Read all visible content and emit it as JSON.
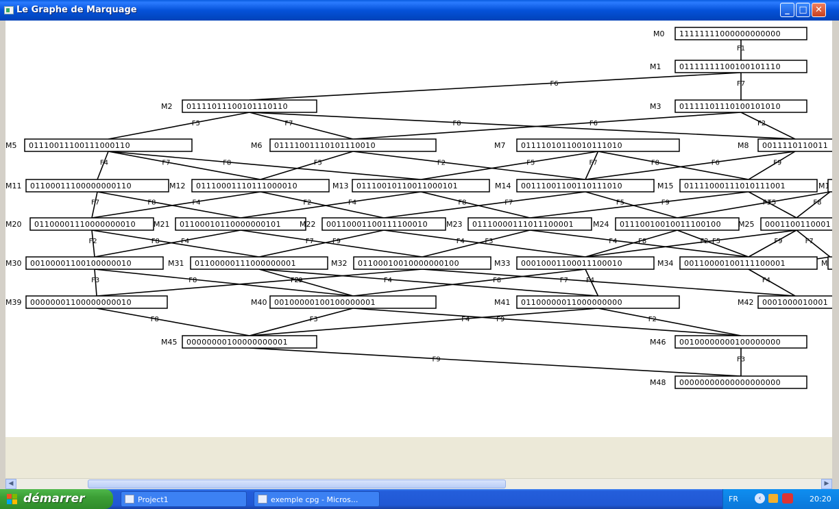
{
  "window": {
    "title": "Le Graphe de Marquage",
    "buttons": {
      "minimize": "_",
      "maximize": "□",
      "close": "✕"
    }
  },
  "graph": {
    "nodes": [
      {
        "id": "M0",
        "value": "11111111000000000000"
      },
      {
        "id": "M1",
        "value": "01111111100100101110"
      },
      {
        "id": "M2",
        "value": "01111011100101110110"
      },
      {
        "id": "M3",
        "value": "01111101110100101010"
      },
      {
        "id": "M5",
        "value": "01110011100111000110"
      },
      {
        "id": "M6",
        "value": "01111001110101110010"
      },
      {
        "id": "M7",
        "value": "01111010110010111010"
      },
      {
        "id": "M8",
        "value": "0011110110011"
      },
      {
        "id": "M11",
        "value": "01100011100000000110"
      },
      {
        "id": "M12",
        "value": "01110001110111000010"
      },
      {
        "id": "M13",
        "value": "01110010110011000101"
      },
      {
        "id": "M14",
        "value": "00111001100110111010"
      },
      {
        "id": "M15",
        "value": "01111000111010111001"
      },
      {
        "id": "M1x",
        "value": ""
      },
      {
        "id": "M20",
        "value": "01100001110000000010"
      },
      {
        "id": "M21",
        "value": "01100010110000000101"
      },
      {
        "id": "M22",
        "value": "00110001100111100010"
      },
      {
        "id": "M23",
        "value": "01110000111011100001"
      },
      {
        "id": "M24",
        "value": "01110010010011100100"
      },
      {
        "id": "M25",
        "value": "0001100110001"
      },
      {
        "id": "M30",
        "value": "00100001100100000010"
      },
      {
        "id": "M31",
        "value": "01100000111000000001"
      },
      {
        "id": "M32",
        "value": "01100010010000000100"
      },
      {
        "id": "M33",
        "value": "00010001100011100010"
      },
      {
        "id": "M34",
        "value": "00110000100111100001"
      },
      {
        "id": "M3x",
        "value": ""
      },
      {
        "id": "M39",
        "value": "00000001100000000010"
      },
      {
        "id": "M40",
        "value": "00100000100100000001"
      },
      {
        "id": "M41",
        "value": "01100000011000000000"
      },
      {
        "id": "M42",
        "value": "0001000010001"
      },
      {
        "id": "M45",
        "value": "00000000100000000001"
      },
      {
        "id": "M46",
        "value": "00100000000100000000"
      },
      {
        "id": "M48",
        "value": "00000000000000000000"
      }
    ],
    "edges": [
      {
        "from": "M0",
        "to": "M1",
        "label": "F1"
      },
      {
        "from": "M1",
        "to": "M2",
        "label": "F6"
      },
      {
        "from": "M1",
        "to": "M3",
        "label": "F7"
      },
      {
        "from": "M2",
        "to": "M5",
        "label": "F5"
      },
      {
        "from": "M2",
        "to": "M6",
        "label": "F7"
      },
      {
        "from": "M2",
        "to": "M8",
        "label": "F8"
      },
      {
        "from": "M3",
        "to": "M6",
        "label": "F6"
      },
      {
        "from": "M3",
        "to": "M8",
        "label": "F2"
      },
      {
        "from": "M5",
        "to": "M11",
        "label": "F4"
      },
      {
        "from": "M5",
        "to": "M12",
        "label": "F7"
      },
      {
        "from": "M5",
        "to": "M13",
        "label": "F8"
      },
      {
        "from": "M6",
        "to": "M12",
        "label": "F5"
      },
      {
        "from": "M6",
        "to": "M14",
        "label": "F2"
      },
      {
        "from": "M7",
        "to": "M13",
        "label": "F5"
      },
      {
        "from": "M7",
        "to": "M15",
        "label": "F8"
      },
      {
        "from": "M7",
        "to": "M14",
        "label": "F7"
      },
      {
        "from": "M8",
        "to": "M15",
        "label": "F9"
      },
      {
        "from": "M8",
        "to": "M14",
        "label": "F6"
      },
      {
        "from": "M11",
        "to": "M20",
        "label": "F7"
      },
      {
        "from": "M11",
        "to": "M21",
        "label": "F8"
      },
      {
        "from": "M12",
        "to": "M20",
        "label": "F4"
      },
      {
        "from": "M12",
        "to": "M22",
        "label": "F2"
      },
      {
        "from": "M13",
        "to": "M21",
        "label": "F4"
      },
      {
        "from": "M13",
        "to": "M23",
        "label": "F8"
      },
      {
        "from": "M14",
        "to": "M22",
        "label": "F7"
      },
      {
        "from": "M14",
        "to": "M24",
        "label": "F5"
      },
      {
        "from": "M15",
        "to": "M23",
        "label": "F9"
      },
      {
        "from": "M15",
        "to": "M25",
        "label": "F3"
      },
      {
        "from": "M1x",
        "to": "M24",
        "label": "F5"
      },
      {
        "from": "M1x",
        "to": "M25",
        "label": "F8"
      },
      {
        "from": "M20",
        "to": "M30",
        "label": "F2"
      },
      {
        "from": "M20",
        "to": "M31",
        "label": "F8"
      },
      {
        "from": "M21",
        "to": "M30",
        "label": "F4"
      },
      {
        "from": "M21",
        "to": "M32",
        "label": "F7"
      },
      {
        "from": "M22",
        "to": "M31",
        "label": "F9"
      },
      {
        "from": "M22",
        "to": "M33",
        "label": "F4"
      },
      {
        "from": "M23",
        "to": "M32",
        "label": "F3"
      },
      {
        "from": "M23",
        "to": "M34",
        "label": "F4"
      },
      {
        "from": "M24",
        "to": "M33",
        "label": "F8"
      },
      {
        "from": "M24",
        "to": "M34",
        "label": "F2"
      },
      {
        "from": "M25",
        "to": "M34",
        "label": "F9"
      },
      {
        "from": "M25",
        "to": "M3x",
        "label": "F7"
      },
      {
        "from": "M25",
        "to": "M33",
        "label": "F5"
      },
      {
        "from": "M30",
        "to": "M39",
        "label": "F3"
      },
      {
        "from": "M30",
        "to": "M40",
        "label": "F8"
      },
      {
        "from": "M31",
        "to": "M40",
        "label": "F2"
      },
      {
        "from": "M31",
        "to": "M41",
        "label": "F4"
      },
      {
        "from": "M32",
        "to": "M39",
        "label": "F9"
      },
      {
        "from": "M32",
        "to": "M42",
        "label": "F7"
      },
      {
        "from": "M33",
        "to": "M41",
        "label": "F4"
      },
      {
        "from": "M33",
        "to": "M40",
        "label": "F8"
      },
      {
        "from": "M34",
        "to": "M42",
        "label": "F4"
      },
      {
        "from": "M34",
        "to": "M3x",
        "label": "F3"
      },
      {
        "from": "M39",
        "to": "M45",
        "label": "F8"
      },
      {
        "from": "M40",
        "to": "M45",
        "label": "F3"
      },
      {
        "from": "M40",
        "to": "M46",
        "label": "F9"
      },
      {
        "from": "M41",
        "to": "M45",
        "label": "F4"
      },
      {
        "from": "M41",
        "to": "M46",
        "label": "F2"
      },
      {
        "from": "M45",
        "to": "M48",
        "label": "F9"
      },
      {
        "from": "M46",
        "to": "M48",
        "label": "F3"
      }
    ]
  },
  "taskbar": {
    "start_label": "démarrer",
    "items": [
      {
        "label": "Project1"
      },
      {
        "label": "exemple cpg - Micros..."
      }
    ],
    "language": "FR",
    "clock": "20:20"
  }
}
